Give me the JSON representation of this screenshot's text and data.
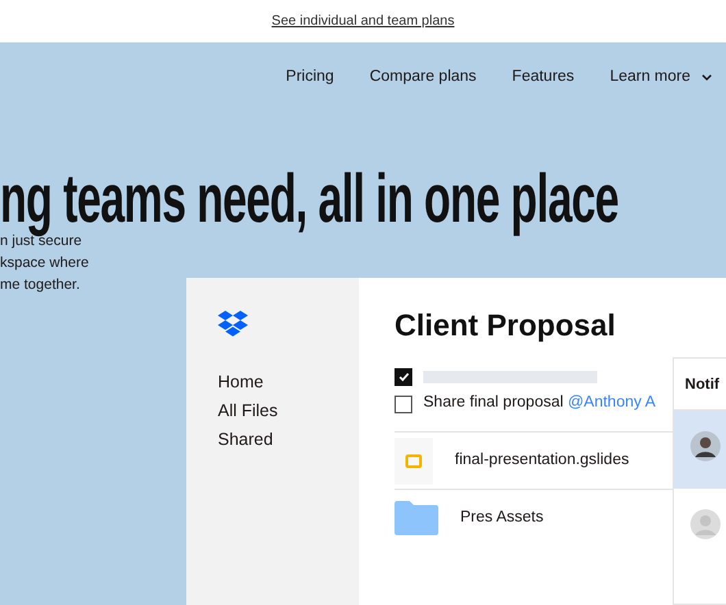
{
  "banner": {
    "link": "See individual and team plans"
  },
  "nav": {
    "items": [
      {
        "label": "Pricing",
        "kind": "link"
      },
      {
        "label": "Compare plans",
        "kind": "link"
      },
      {
        "label": "Features",
        "kind": "link"
      },
      {
        "label": "Learn more",
        "kind": "dropdown"
      }
    ]
  },
  "headline": "ng teams need, all in one place",
  "intro_lines": [
    "n just secure",
    "kspace where",
    "me together."
  ],
  "app": {
    "sidebar": {
      "items": [
        "Home",
        "All Files",
        "Shared"
      ]
    },
    "title": "Client Proposal",
    "tasks": [
      {
        "checked": true
      },
      {
        "checked": false,
        "text": "Share final proposal",
        "mention": "@Anthony A"
      }
    ],
    "files": [
      {
        "kind": "slides",
        "name": "final-presentation.gslides"
      },
      {
        "kind": "folder",
        "name": "Pres Assets"
      }
    ],
    "notifications": {
      "title": "Notif",
      "items": [
        {
          "selected": true
        },
        {
          "selected": false
        }
      ]
    }
  }
}
